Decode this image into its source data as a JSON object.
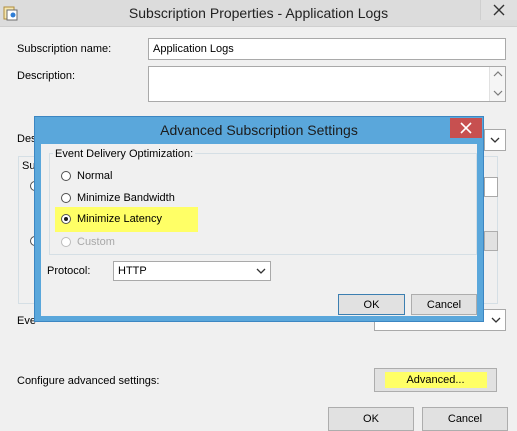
{
  "window": {
    "title": "Subscription Properties - Application Logs",
    "subscription_name_label": "Subscription name:",
    "subscription_name_value": "Application Logs",
    "description_label": "Description:",
    "partial_label_de": "Des",
    "partial_label_su": "Su",
    "partial_label_eve": "Eve",
    "configure_label": "Configure advanced settings:",
    "advanced_button": "Advanced...",
    "ok_button": "OK",
    "cancel_button": "Cancel"
  },
  "dialog": {
    "title": "Advanced Subscription Settings",
    "group_label": "Event Delivery Optimization:",
    "options": [
      {
        "label": "Normal",
        "selected": false,
        "enabled": true
      },
      {
        "label": "Minimize Bandwidth",
        "selected": false,
        "enabled": true
      },
      {
        "label": "Minimize Latency",
        "selected": true,
        "enabled": true
      },
      {
        "label": "Custom",
        "selected": false,
        "enabled": false
      }
    ],
    "protocol_label": "Protocol:",
    "protocol_value": "HTTP",
    "ok_button": "OK",
    "cancel_button": "Cancel"
  },
  "colors": {
    "highlight": "#ffff66",
    "dialog_frame": "#5aa7db",
    "close_button": "#c75050"
  },
  "icons": [
    "app-icon",
    "close-icon",
    "chevron-down-icon",
    "scroll-up-icon",
    "scroll-down-icon"
  ]
}
